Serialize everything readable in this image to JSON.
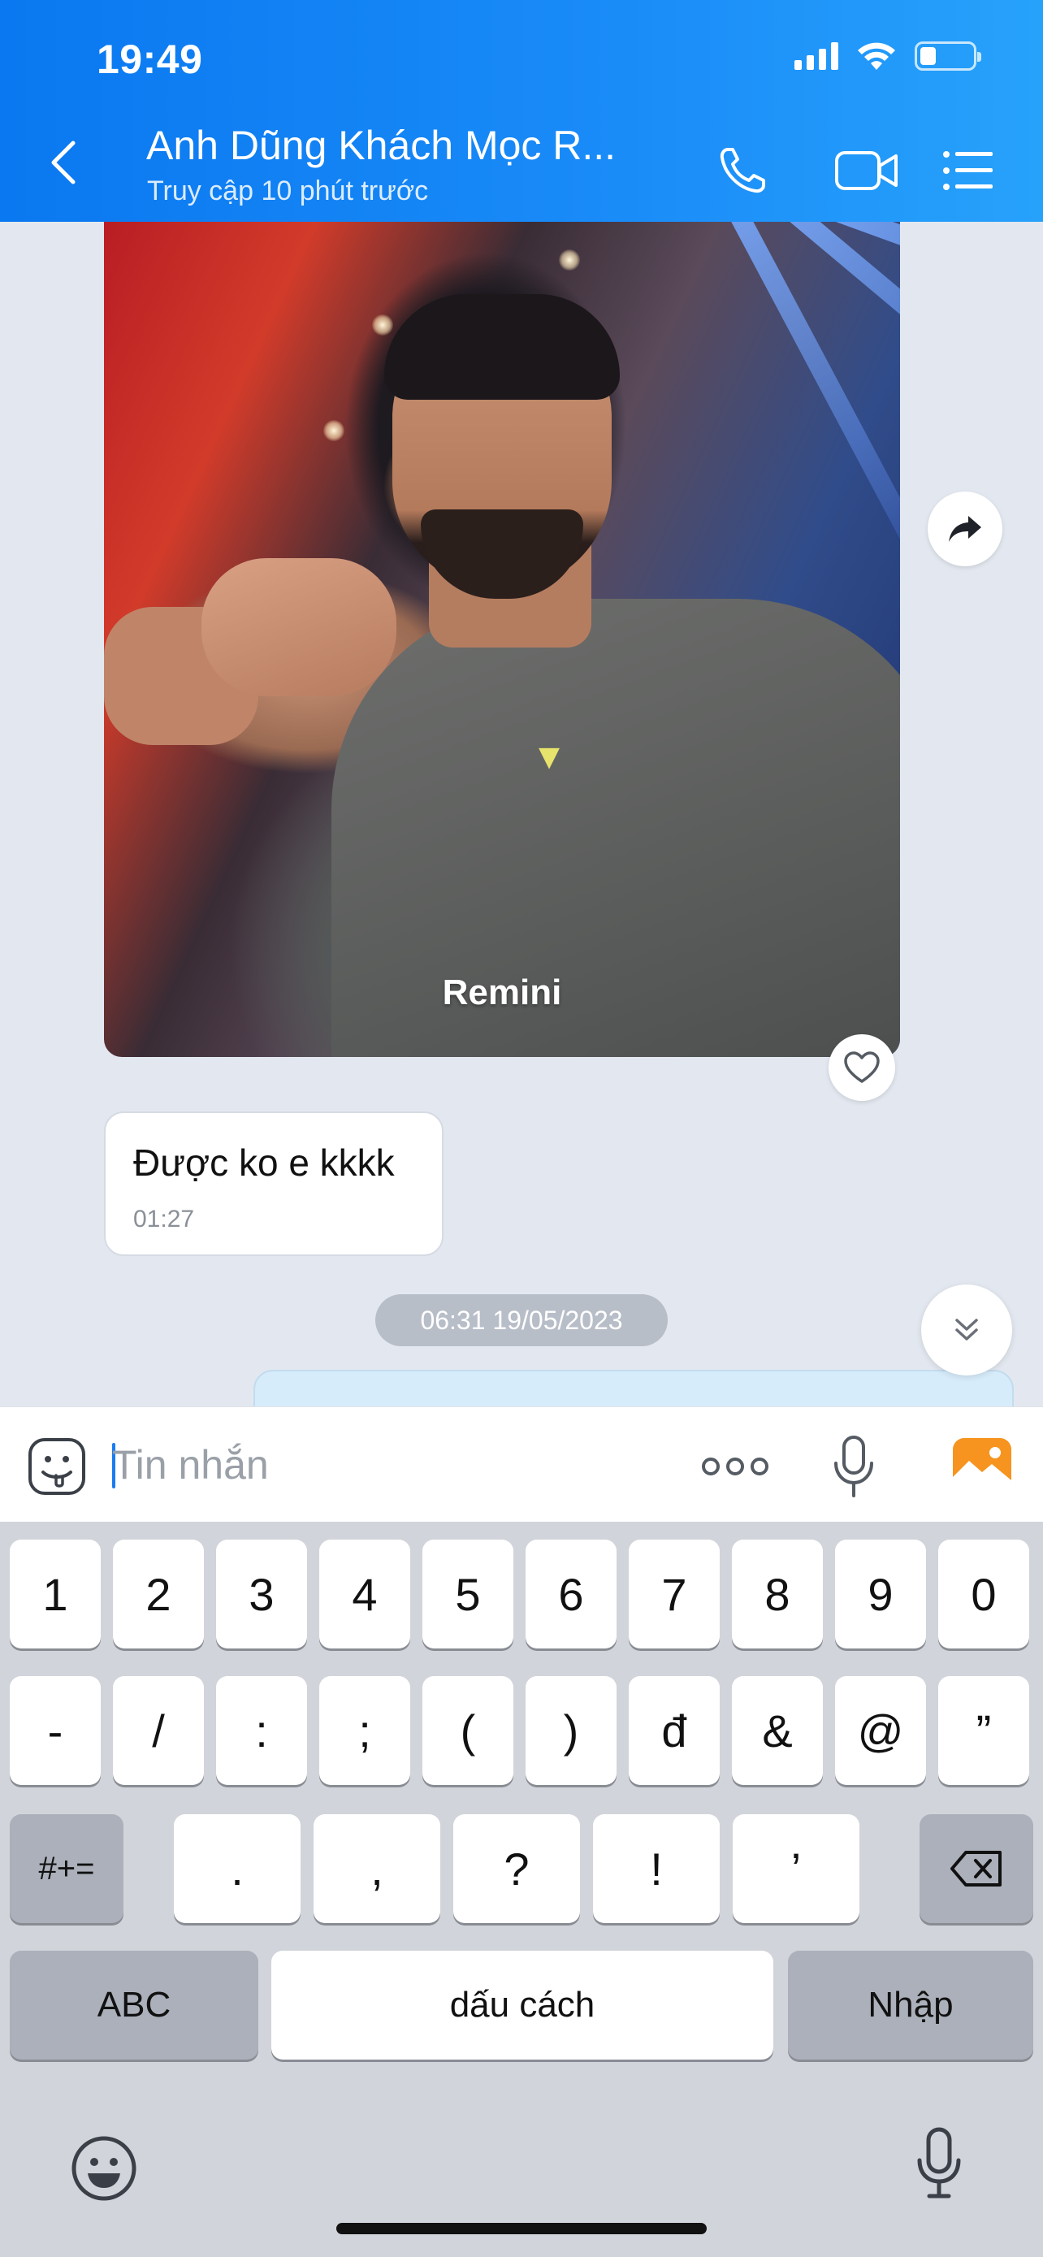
{
  "status_bar": {
    "time": "19:49",
    "battery_level": 0.3
  },
  "header": {
    "contact_name": "Anh Dũng Khách Mọc R...",
    "last_seen": "Truy cập 10 phút trước",
    "icons": [
      "back-icon",
      "phone-icon",
      "video-call-icon",
      "menu-list-icon"
    ],
    "background": "#1a8cf8"
  },
  "messages": {
    "photo_watermark": "Remini",
    "incoming_text": "Được ko e kkkk",
    "incoming_time": "01:27",
    "date_separator": "06:31 19/05/2023"
  },
  "composer": {
    "placeholder": "Tin nhắn",
    "icons": [
      "sticker-icon",
      "more-icon",
      "microphone-icon",
      "gallery-icon"
    ]
  },
  "keyboard": {
    "row1": [
      "1",
      "2",
      "3",
      "4",
      "5",
      "6",
      "7",
      "8",
      "9",
      "0"
    ],
    "row2": [
      "-",
      "/",
      ":",
      ";",
      "(",
      ")",
      "đ",
      "&",
      "@",
      "”"
    ],
    "row3_left": "#+=",
    "row3": [
      ".",
      ",",
      "?",
      "!",
      "’"
    ],
    "abc": "ABC",
    "space": "dấu cách",
    "return": "Nhập",
    "icons": [
      "delete-icon",
      "emoji-keyboard-icon",
      "dictation-icon"
    ]
  }
}
